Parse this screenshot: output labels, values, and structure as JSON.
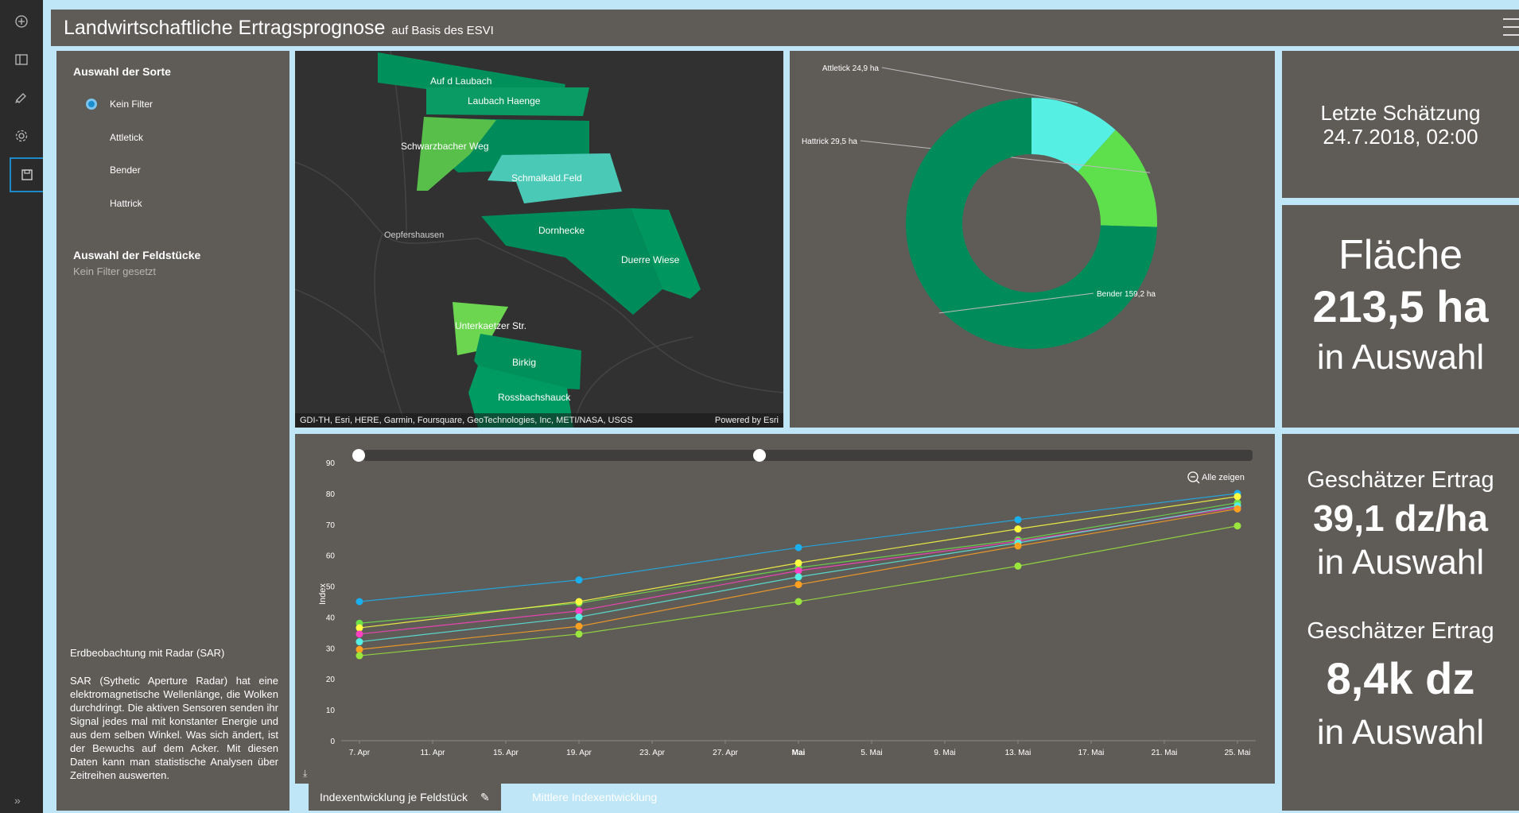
{
  "header": {
    "title": "Landwirtschaftliche Ertragsprognose",
    "subtitle": "auf Basis des ESVI"
  },
  "toolbar": {
    "items": [
      {
        "icon": "add-circle-icon"
      },
      {
        "icon": "layout-icon"
      },
      {
        "icon": "theme-icon"
      },
      {
        "icon": "gear-icon"
      },
      {
        "icon": "save-icon",
        "active": true
      }
    ],
    "expand_label": "»"
  },
  "filters": {
    "sorte_title": "Auswahl der Sorte",
    "sorte_options": [
      "Kein Filter",
      "Attletick",
      "Bender",
      "Hattrick"
    ],
    "sorte_selected": "Kein Filter",
    "feld_title": "Auswahl der Feldstücke",
    "feld_value": "Kein Filter gesetzt"
  },
  "sar": {
    "title": "Erdbeobachtung mit Radar (SAR)",
    "text": "SAR (Sythetic Aperture Radar) hat eine elektromagnetische Wellenlänge, die Wolken durchdringt. Die aktiven Sensoren senden ihr Signal jedes mal mit konstanter Energie und aus dem selben Winkel. Was sich ändert, ist der Bewuchs auf dem Acker. Mit diesen Daten kann man statistische Analysen über Zeitreihen auswerten."
  },
  "map": {
    "fields": [
      "Auf d Laubach",
      "Laubach Haenge",
      "Schwarzbacher Weg",
      "Schmalkald.Feld",
      "Dornhecke",
      "Duerre Wiese",
      "Unterkaetzer Str.",
      "Birkig",
      "Rossbachshauck"
    ],
    "town": "Oepfershausen",
    "attribution": "GDI-TH, Esri, HERE, Garmin, Foursquare, GeoTechnologies, Inc, METI/NASA, USGS",
    "powered": "Powered by Esri"
  },
  "donut": {
    "labels": [
      "Attletick 24,9 ha",
      "Hattrick 29,5 ha",
      "Bender 159,2 ha"
    ],
    "values": [
      24.9,
      29.5,
      159.2
    ],
    "colors": [
      "#56efe3",
      "#5ee04d",
      "#008c5a"
    ]
  },
  "kpi": {
    "last_label": "Letzte Schätzung",
    "last_value": "24.7.2018, 02:00",
    "area_label": "Fläche",
    "area_value": "213,5 ha",
    "area_sub": "in Auswahl",
    "yield_label": "Geschätzer Ertrag",
    "yield_value": "39,1 dz/ha",
    "yield_sub": "in Auswahl",
    "total_label": "Geschätzer Ertrag",
    "total_value": "8,4k dz",
    "total_sub": "in Auswahl"
  },
  "chart": {
    "zoom_label": "Alle zeigen",
    "download_icon": "download-icon"
  },
  "tabs": {
    "active": "Indexentwicklung je Feldstück",
    "inactive": "Mittlere Indexentwicklung"
  },
  "chart_data": {
    "type": "line",
    "ylabel": "Index",
    "ylim": [
      0,
      90
    ],
    "yticks": [
      0,
      10,
      20,
      30,
      40,
      50,
      60,
      70,
      80,
      90
    ],
    "xlim": [
      "2018-04-06",
      "2018-05-26"
    ],
    "xticks": [
      "7. Apr",
      "11. Apr",
      "15. Apr",
      "19. Apr",
      "23. Apr",
      "27. Apr",
      "Mai",
      "5. Mai",
      "9. Mai",
      "13. Mai",
      "17. Mai",
      "21. Mai",
      "25. Mai"
    ],
    "x": [
      "2018-04-07",
      "2018-04-19",
      "2018-05-01",
      "2018-05-13",
      "2018-05-25"
    ],
    "series": [
      {
        "color": "#1ab0f0",
        "values": [
          45,
          52,
          62.5,
          71.5,
          80
        ]
      },
      {
        "color": "#6ee04a",
        "values": [
          38,
          44.5,
          56,
          65,
          77
        ]
      },
      {
        "color": "#ffff40",
        "values": [
          36.5,
          45,
          57.5,
          68.5,
          79
        ]
      },
      {
        "color": "#ff40c0",
        "values": [
          34.5,
          42,
          55,
          64.5,
          75.5
        ]
      },
      {
        "color": "#56efe3",
        "values": [
          32,
          40,
          53,
          64,
          76
        ]
      },
      {
        "color": "#ffa020",
        "values": [
          29.5,
          37,
          50.5,
          63,
          75
        ]
      },
      {
        "color": "#9ae63c",
        "values": [
          27.5,
          34.5,
          45,
          56.5,
          69.5
        ]
      }
    ]
  }
}
